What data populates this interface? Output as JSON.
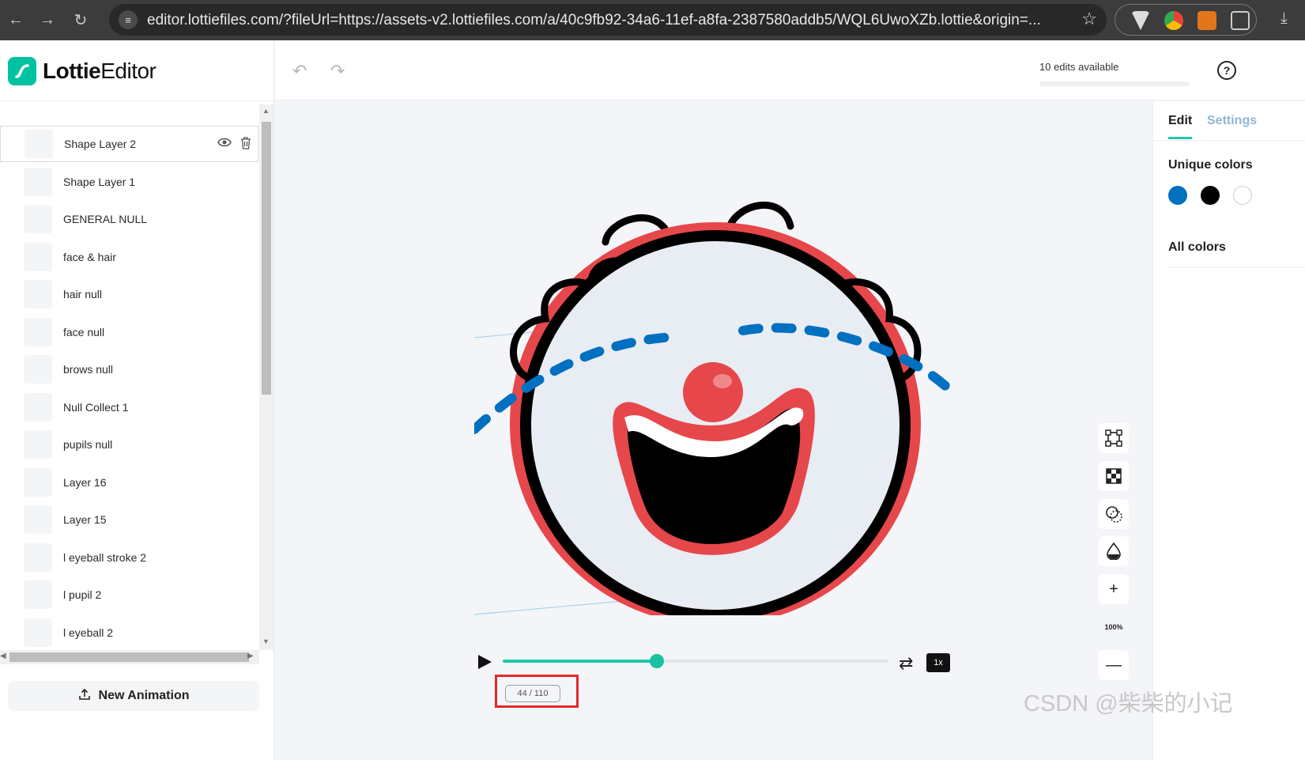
{
  "browser": {
    "url": "editor.lottiefiles.com/?fileUrl=https://assets-v2.lottiefiles.com/a/40c9fb92-34a6-11ef-a8fa-2387580addb5/WQL6UwoXZb.lottie&origin=...",
    "icons": [
      "back-icon",
      "forward-icon",
      "reload-icon",
      "site-settings-icon",
      "star-icon",
      "extensions-icon",
      "download-icon"
    ]
  },
  "app": {
    "logo_part1": "Lottie",
    "logo_part2": "Editor"
  },
  "topbar": {
    "edits_available": "10 edits available",
    "help": "?"
  },
  "layers": [
    {
      "name": "Shape Layer 2",
      "selected": true
    },
    {
      "name": "Shape Layer 1"
    },
    {
      "name": "GENERAL NULL"
    },
    {
      "name": "face & hair"
    },
    {
      "name": "hair null"
    },
    {
      "name": "face null"
    },
    {
      "name": "brows null"
    },
    {
      "name": "Null Collect 1"
    },
    {
      "name": "pupils null"
    },
    {
      "name": "Layer 16"
    },
    {
      "name": "Layer 15"
    },
    {
      "name": "l eyeball stroke 2"
    },
    {
      "name": "l pupil 2"
    },
    {
      "name": "l eyeball 2"
    }
  ],
  "sidebar": {
    "new_animation": "New Animation"
  },
  "player": {
    "current_frame": 44,
    "total_frames": 110,
    "frame_label": "44 / 110",
    "speed": "1x",
    "progress": 0.4
  },
  "tools": {
    "zoom": "100%"
  },
  "panel": {
    "tabs": [
      "Edit",
      "Settings"
    ],
    "unique_colors": "Unique colors",
    "all_colors": "All colors",
    "colors": [
      "#0070c0",
      "#000000",
      "#ffffff"
    ]
  },
  "watermark": "CSDN @柴柴的小记"
}
